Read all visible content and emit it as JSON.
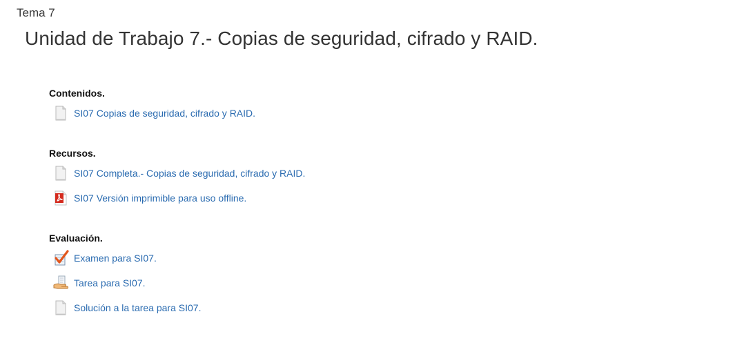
{
  "section": {
    "label": "Tema 7",
    "title": "Unidad de Trabajo 7.- Copias de seguridad, cifrado y RAID."
  },
  "groups": [
    {
      "heading": "Contenidos.",
      "items": [
        {
          "label": "SI07 Copias de seguridad, cifrado y RAID.",
          "icon": "page-icon"
        }
      ]
    },
    {
      "heading": "Recursos.",
      "items": [
        {
          "label": "SI07 Completa.- Copias de seguridad, cifrado y RAID.",
          "icon": "page-icon"
        },
        {
          "label": "SI07 Versión imprimible para uso offline.",
          "icon": "pdf-icon"
        }
      ]
    },
    {
      "heading": "Evaluación.",
      "items": [
        {
          "label": "Examen para SI07.",
          "icon": "quiz-checkmark-icon"
        },
        {
          "label": "Tarea para SI07.",
          "icon": "assignment-hand-icon"
        },
        {
          "label": "Solución a la tarea para SI07.",
          "icon": "page-icon"
        }
      ]
    }
  ],
  "colors": {
    "link": "#2a6bb0",
    "heading": "#111111",
    "title": "#333333"
  }
}
